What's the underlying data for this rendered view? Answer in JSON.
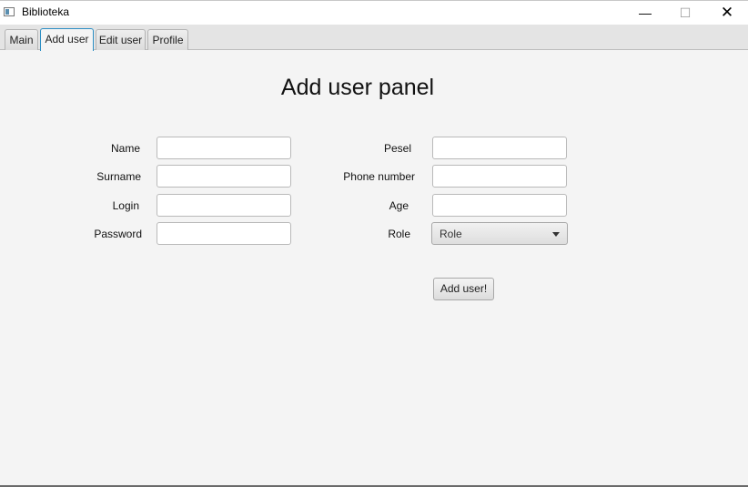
{
  "window": {
    "title": "Biblioteka",
    "minimize_glyph": "—",
    "maximize_glyph": "☐",
    "close_glyph": "✕"
  },
  "tabs": [
    {
      "label": "Main",
      "active": false
    },
    {
      "label": "Add user",
      "active": true
    },
    {
      "label": "Edit user",
      "active": false
    },
    {
      "label": "Profile",
      "active": false
    }
  ],
  "panel": {
    "title": "Add user panel"
  },
  "form": {
    "name_label": "Name",
    "surname_label": "Surname",
    "login_label": "Login",
    "password_label": "Password",
    "pesel_label": "Pesel",
    "phone_label": "Phone number",
    "age_label": "Age",
    "role_label": "Role",
    "name_value": "",
    "surname_value": "",
    "login_value": "",
    "password_value": "",
    "pesel_value": "",
    "phone_value": "",
    "age_value": "",
    "role_selected": "Role",
    "submit_label": "Add user!"
  },
  "colors": {
    "background": "#f4f4f4",
    "active_tab_border": "#2c8ec4",
    "input_border": "#b9b9b9"
  }
}
